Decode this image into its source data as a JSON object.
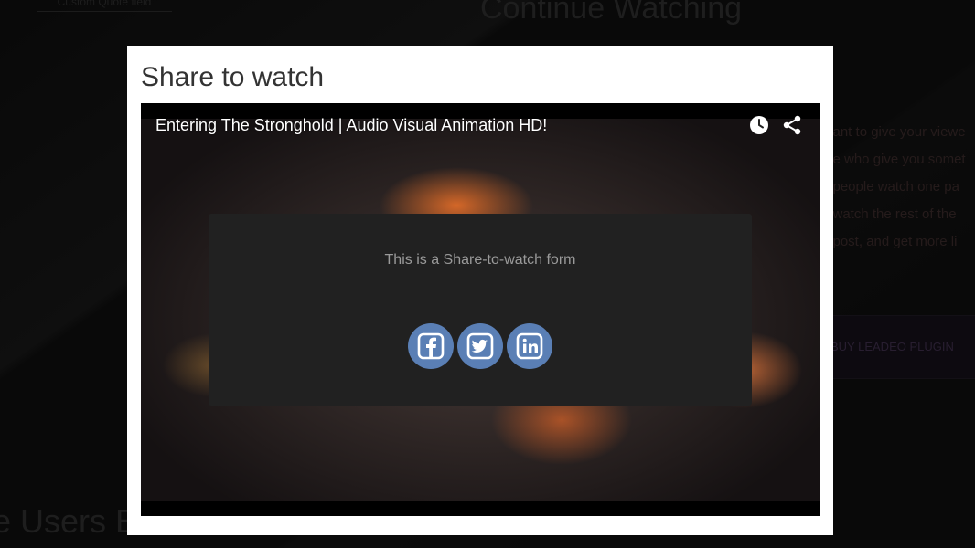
{
  "background": {
    "quote_field": "Custom Quote field",
    "heading": "Continue Watching",
    "paragraph_lines": [
      "...ant to give your viewe",
      "...e who give you somet",
      "...people watch one pa",
      "...watch the rest of the",
      "...post, and get more li"
    ],
    "buy_button": "BUY LEADEO PLUGIN",
    "users_heading": "e Users E..."
  },
  "modal": {
    "title": "Share to watch",
    "video": {
      "title": "Entering The Stronghold | Audio Visual Animation HD!",
      "watch_later_icon": "clock-icon",
      "share_icon": "share-icon"
    },
    "form": {
      "text": "This is a Share-to-watch form",
      "buttons": [
        {
          "network": "facebook",
          "icon": "facebook-icon"
        },
        {
          "network": "twitter",
          "icon": "twitter-icon"
        },
        {
          "network": "linkedin",
          "icon": "linkedin-icon"
        }
      ],
      "button_color": "#5a7fb5"
    }
  }
}
